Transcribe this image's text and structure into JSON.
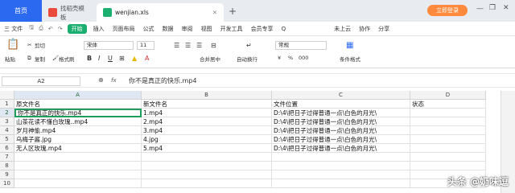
{
  "tabs": {
    "home": "首页",
    "templates": "找稻壳模板",
    "file": "wenjian.xls"
  },
  "login": "立即登录",
  "menu": {
    "file": "三 文件",
    "start": "开始",
    "items": [
      "插入",
      "页面布局",
      "公式",
      "数据",
      "审阅",
      "视图",
      "开发工具",
      "会员专享"
    ],
    "search": "Q",
    "cloud": "未上云",
    "collab": "协作",
    "share": "分享"
  },
  "ribbon": {
    "paste": "粘贴",
    "cut": "剪切",
    "copy": "复制",
    "format_painter": "格式刷",
    "font": "宋体",
    "size": "11",
    "merge": "合并居中",
    "wrap": "自动换行",
    "number_format": "常规",
    "cond_format": "条件格式",
    "currency": "¥",
    "percent": "%",
    "thousands": "000"
  },
  "formula": {
    "cell_ref": "A2",
    "fx": "fx",
    "value": "你不是真正的快乐.mp4"
  },
  "columns": [
    "A",
    "B",
    "C",
    "D"
  ],
  "rows": [
    [
      "原文件名",
      "新文件名",
      "文件位置",
      "状态"
    ],
    [
      "你不是真正的快乐.mp4",
      "1.mp4",
      "D:\\4\\把日子过得普通一点\\白色的月光\\",
      ""
    ],
    [
      "山茶花读不懂白玫瑰..mp4",
      "2.mp4",
      "D:\\4\\把日子过得普通一点\\白色的月光\\",
      ""
    ],
    [
      "岁月神偷.mp4",
      "3.mp4",
      "D:\\4\\把日子过得普通一点\\白色的月光\\",
      ""
    ],
    [
      "乌梅子酱.jpg",
      "4.jpg",
      "D:\\4\\把日子过得普通一点\\白色的月光\\",
      ""
    ],
    [
      "无人区玫瑰.mp4",
      "5.mp4",
      "D:\\4\\把日子过得普通一点\\白色的月光\\",
      ""
    ],
    [
      "",
      "",
      "",
      ""
    ],
    [
      "",
      "",
      "",
      ""
    ],
    [
      "",
      "",
      "",
      ""
    ],
    [
      "",
      "",
      "",
      ""
    ]
  ],
  "watermark": "头条 @奶味逗",
  "colors": {
    "accent": "#2b69f0",
    "start": "#1aae6f",
    "login": "#ff8a3d",
    "selection": "#1e9e5c"
  }
}
